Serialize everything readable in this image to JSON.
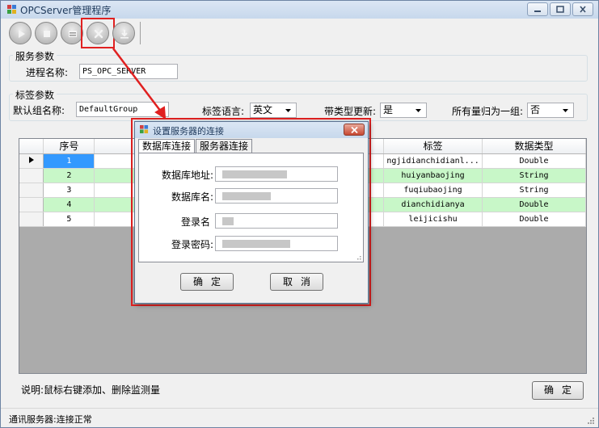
{
  "window": {
    "title": "OPCServer管理程序"
  },
  "service_group": {
    "legend": "服务参数",
    "process_label": "进程名称:",
    "process_value": "PS_OPC_SERVER"
  },
  "tag_group": {
    "legend": "标签参数",
    "default_group_label": "默认组名称:",
    "default_group_value": "DefaultGroup",
    "language_label": "标签语言:",
    "language_value": "英文",
    "typed_update_label": "带类型更新:",
    "typed_update_value": "是",
    "single_group_label": "所有量归为一组:",
    "single_group_value": "否"
  },
  "grid": {
    "columns": [
      "序号",
      "",
      "",
      "标签",
      "数据类型"
    ],
    "rows": [
      {
        "no": "1",
        "tag": "ngjidianchidianl...",
        "type": "Double"
      },
      {
        "no": "2",
        "tag": "huiyanbaojing",
        "type": "String"
      },
      {
        "no": "3",
        "tag": "fuqiubaojing",
        "type": "String"
      },
      {
        "no": "4",
        "tag": "dianchidianya",
        "type": "Double"
      },
      {
        "no": "5",
        "tag": "leijicishu",
        "type": "Double"
      }
    ]
  },
  "footer": {
    "note": "说明:鼠标右键添加、删除监测量",
    "ok_label": "确定"
  },
  "status": {
    "text": "通讯服务器:连接正常"
  },
  "dialog": {
    "title": "设置服务器的连接",
    "tabs": [
      "数据库连接",
      "服务器连接"
    ],
    "fields": {
      "address_label": "数据库地址:",
      "dbname_label": "数据库名:",
      "login_label": "登录名",
      "password_label": "登录密码:"
    },
    "ok_label": "确定",
    "cancel_label": "取消"
  },
  "colors": {
    "highlight": "#e02020",
    "selected_cell": "#3399ff",
    "alt_row": "#c8f7c8"
  }
}
